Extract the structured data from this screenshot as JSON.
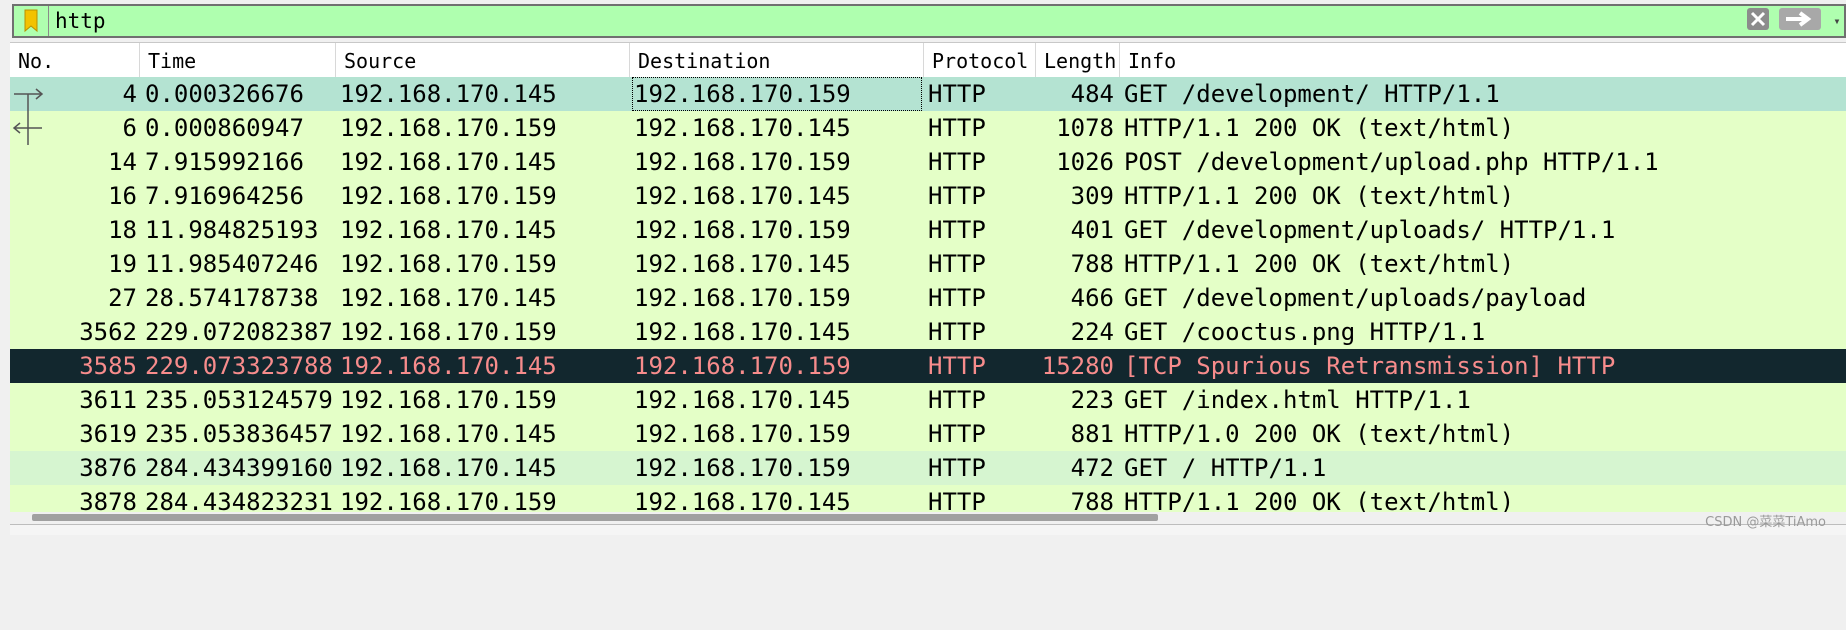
{
  "filter": {
    "value": "http",
    "bookmark_icon": "bookmark-icon",
    "clear_icon": "clear-x-icon",
    "apply_icon": "arrow-right-icon",
    "dropdown_icon": "chevron-down-icon"
  },
  "columns": {
    "no": "No.",
    "time": "Time",
    "source": "Source",
    "destination": "Destination",
    "protocol": "Protocol",
    "length": "Length",
    "info": "Info"
  },
  "colors": {
    "http_row": "#e4ffc7",
    "selected_row": "#b4e3d2",
    "alt_row": "#d6f5d0",
    "dark_row": "#12272e",
    "dark_row_text": "#f78c8c",
    "filter_bg": "#afffaf"
  },
  "packets": [
    {
      "no": "4",
      "time": "0.000326676",
      "source": "192.168.170.145",
      "destination": "192.168.170.159",
      "protocol": "HTTP",
      "length": "484",
      "info": "GET /development/ HTTP/1.1",
      "style": "selected",
      "relation": "request"
    },
    {
      "no": "6",
      "time": "0.000860947",
      "source": "192.168.170.159",
      "destination": "192.168.170.145",
      "protocol": "HTTP",
      "length": "1078",
      "info": "HTTP/1.1 200 OK  (text/html)",
      "style": "normal",
      "relation": "response"
    },
    {
      "no": "14",
      "time": "7.915992166",
      "source": "192.168.170.145",
      "destination": "192.168.170.159",
      "protocol": "HTTP",
      "length": "1026",
      "info": "POST /development/upload.php HTTP/1.1",
      "style": "normal"
    },
    {
      "no": "16",
      "time": "7.916964256",
      "source": "192.168.170.159",
      "destination": "192.168.170.145",
      "protocol": "HTTP",
      "length": "309",
      "info": "HTTP/1.1 200 OK  (text/html)",
      "style": "normal"
    },
    {
      "no": "18",
      "time": "11.984825193",
      "source": "192.168.170.145",
      "destination": "192.168.170.159",
      "protocol": "HTTP",
      "length": "401",
      "info": "GET /development/uploads/ HTTP/1.1",
      "style": "normal"
    },
    {
      "no": "19",
      "time": "11.985407246",
      "source": "192.168.170.159",
      "destination": "192.168.170.145",
      "protocol": "HTTP",
      "length": "788",
      "info": "HTTP/1.1 200 OK  (text/html)",
      "style": "normal"
    },
    {
      "no": "27",
      "time": "28.574178738",
      "source": "192.168.170.145",
      "destination": "192.168.170.159",
      "protocol": "HTTP",
      "length": "466",
      "info": "GET /development/uploads/payload",
      "style": "normal"
    },
    {
      "no": "3562",
      "time": "229.072082387",
      "source": "192.168.170.159",
      "destination": "192.168.170.145",
      "protocol": "HTTP",
      "length": "224",
      "info": "GET /cooctus.png HTTP/1.1",
      "style": "normal"
    },
    {
      "no": "3585",
      "time": "229.073323788",
      "source": "192.168.170.145",
      "destination": "192.168.170.159",
      "protocol": "HTTP",
      "length": "15280",
      "info": "[TCP Spurious Retransmission] HTTP",
      "style": "dark"
    },
    {
      "no": "3611",
      "time": "235.053124579",
      "source": "192.168.170.159",
      "destination": "192.168.170.145",
      "protocol": "HTTP",
      "length": "223",
      "info": "GET /index.html HTTP/1.1",
      "style": "normal"
    },
    {
      "no": "3619",
      "time": "235.053836457",
      "source": "192.168.170.145",
      "destination": "192.168.170.159",
      "protocol": "HTTP",
      "length": "881",
      "info": "HTTP/1.0 200 OK  (text/html)",
      "style": "normal"
    },
    {
      "no": "3876",
      "time": "284.434399160",
      "source": "192.168.170.145",
      "destination": "192.168.170.159",
      "protocol": "HTTP",
      "length": "472",
      "info": "GET / HTTP/1.1",
      "style": "alt"
    },
    {
      "no": "3878",
      "time": "284.434823231",
      "source": "192.168.170.159",
      "destination": "192.168.170.145",
      "protocol": "HTTP",
      "length": "788",
      "info": "HTTP/1.1 200 OK  (text/html)",
      "style": "normal"
    }
  ],
  "scrollbar": {
    "position": 0,
    "visible_fraction": 0.62
  },
  "watermark": "CSDN @菜菜TiAmo"
}
